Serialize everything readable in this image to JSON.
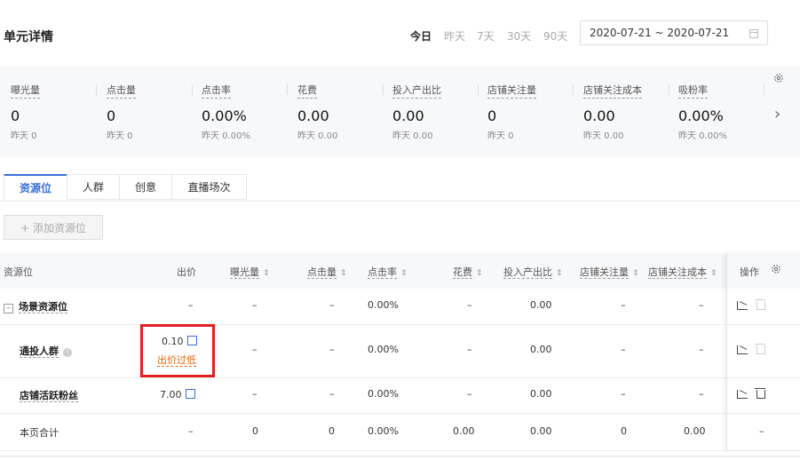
{
  "header": {
    "title": "单元详情",
    "ranges": [
      "今日",
      "昨天",
      "7天",
      "30天",
      "90天"
    ],
    "active_range": "今日",
    "date_range": "2020-07-21 ~ 2020-07-21"
  },
  "metrics": [
    {
      "label": "曝光量",
      "value": "0",
      "compare": "昨天 0"
    },
    {
      "label": "点击量",
      "value": "0",
      "compare": "昨天 0"
    },
    {
      "label": "点击率",
      "value": "0.00%",
      "compare": "昨天 0.00%"
    },
    {
      "label": "花费",
      "value": "0.00",
      "compare": "昨天 0.00"
    },
    {
      "label": "投入产出比",
      "value": "0.00",
      "compare": "昨天 0.00"
    },
    {
      "label": "店铺关注量",
      "value": "0",
      "compare": "昨天 0"
    },
    {
      "label": "店铺关注成本",
      "value": "0.00",
      "compare": "昨天 0.00"
    },
    {
      "label": "吸粉率",
      "value": "0.00%",
      "compare": "昨天 0.00%"
    }
  ],
  "tabs": [
    "资源位",
    "人群",
    "创意",
    "直播场次"
  ],
  "add_button": "+ 添加资源位",
  "table": {
    "columns": [
      "资源位",
      "出价",
      "曝光量",
      "点击量",
      "点击率",
      "花费",
      "投入产出比",
      "店铺关注量",
      "店铺关注成本",
      "操作"
    ],
    "rows": [
      {
        "name": "场景资源位",
        "bid": "–",
        "exposure": "–",
        "clicks": "–",
        "ctr": "0.00%",
        "cost": "–",
        "roi": "0.00",
        "follows": "–",
        "follow_cost": "–"
      },
      {
        "name": "通投人群",
        "bid": "0.10",
        "bid_warning": "出价过低",
        "exposure": "–",
        "clicks": "–",
        "ctr": "0.00%",
        "cost": "–",
        "roi": "0.00",
        "follows": "–",
        "follow_cost": "–"
      },
      {
        "name": "店铺活跃粉丝",
        "bid": "7.00",
        "exposure": "–",
        "clicks": "–",
        "ctr": "0.00%",
        "cost": "–",
        "roi": "0.00",
        "follows": "–",
        "follow_cost": "–"
      },
      {
        "name": "本页合计",
        "bid": "–",
        "exposure": "0",
        "clicks": "0",
        "ctr": "0.00%",
        "cost": "0.00",
        "roi": "0.00",
        "follows": "0",
        "follow_cost": "0.00",
        "op": "–"
      }
    ]
  },
  "colors": {
    "accent": "#3b6fd8",
    "warning": "#e3650f",
    "highlight_box": "#e02020"
  }
}
